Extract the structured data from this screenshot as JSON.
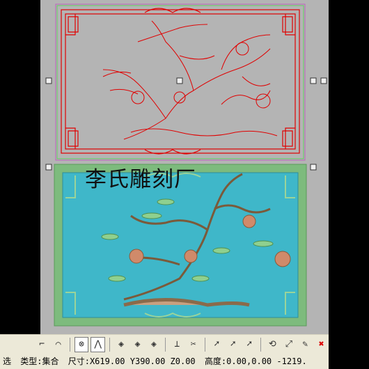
{
  "app": {
    "watermark": "李氏雕刻厂"
  },
  "canvas": {
    "wireframe": {
      "stroke_color": "#e00000",
      "selection_color": "#c060c0"
    },
    "relief": {
      "background_color": "#3fb7c9",
      "frame_color": "#7dbb7d"
    }
  },
  "toolbar": {
    "items": [
      {
        "icon": "curve-tool-icon",
        "glyph": "⌐"
      },
      {
        "icon": "arc-tool-icon",
        "glyph": "⌒"
      },
      {
        "icon": "node-select-icon",
        "glyph": "⊗"
      },
      {
        "icon": "node-edit-icon",
        "glyph": "⋀"
      },
      {
        "icon": "diamond-node-icon",
        "glyph": "◈"
      },
      {
        "icon": "diamond-node-2-icon",
        "glyph": "◈"
      },
      {
        "icon": "diamond-node-3-icon",
        "glyph": "◈"
      },
      {
        "icon": "align-bottom-icon",
        "glyph": "⊥"
      },
      {
        "icon": "trim-curve-icon",
        "glyph": "✂"
      },
      {
        "icon": "pointer-icon",
        "glyph": "➚"
      },
      {
        "icon": "pointer-cut-icon",
        "glyph": "➚"
      },
      {
        "icon": "pointer-delete-icon",
        "glyph": "➚"
      },
      {
        "icon": "rotate-icon",
        "glyph": "⟲"
      },
      {
        "icon": "scale-icon",
        "glyph": "⤢"
      },
      {
        "icon": "edit-node-icon",
        "glyph": "✎"
      },
      {
        "icon": "delete-icon",
        "glyph": "✖"
      }
    ]
  },
  "status": {
    "prefix": "选",
    "type_label": "类型:集合",
    "size_label": "尺寸:X619.00 Y390.00 Z0.00",
    "height_label": "高度:0.00,0.00 -1219."
  }
}
